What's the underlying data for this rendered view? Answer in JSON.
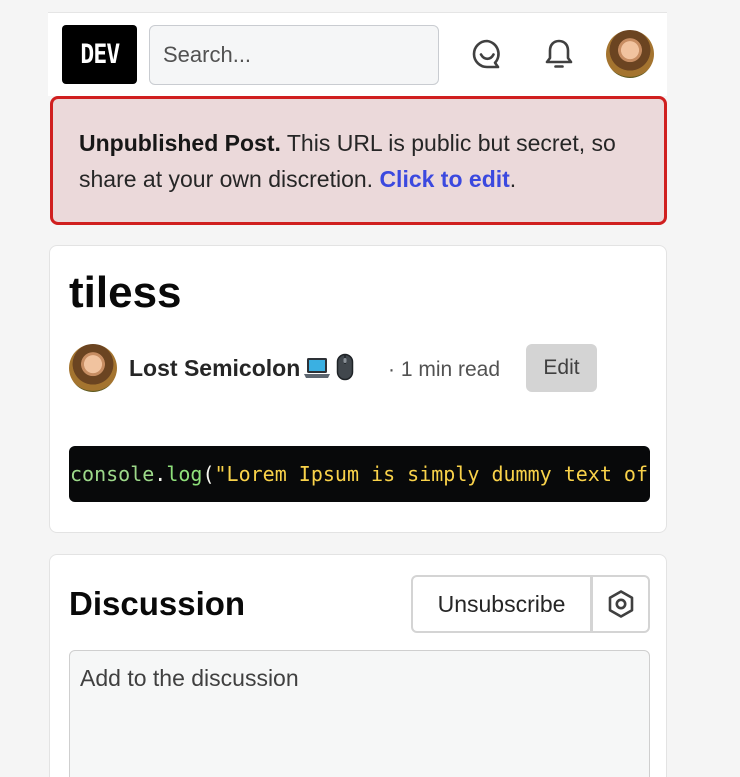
{
  "header": {
    "logo_text": "DEV",
    "search_placeholder": "Search...",
    "icons": [
      "chat-icon",
      "bell-icon",
      "user-avatar"
    ]
  },
  "banner": {
    "bold": "Unpublished Post.",
    "text": " This URL is public but secret, so share at your own discretion. ",
    "link": "Click to edit",
    "end": "."
  },
  "article": {
    "title": "tiless",
    "author": "Lost Semicolon",
    "author_emoji": [
      "laptop-icon",
      "mouse-icon"
    ],
    "read_time": "· 1 min read",
    "edit_label": "Edit",
    "code": {
      "obj": "console",
      "dot": ".",
      "fn": "log",
      "paren": "(",
      "str": "\"Lorem Ipsum is simply dummy text of"
    }
  },
  "discussion": {
    "title": "Discussion",
    "unsubscribe_label": "Unsubscribe",
    "comment_placeholder": "Add to the discussion"
  },
  "colors": {
    "accent": "#3b49df",
    "banner_border": "#d01f1f",
    "banner_bg": "#ebd9da"
  }
}
